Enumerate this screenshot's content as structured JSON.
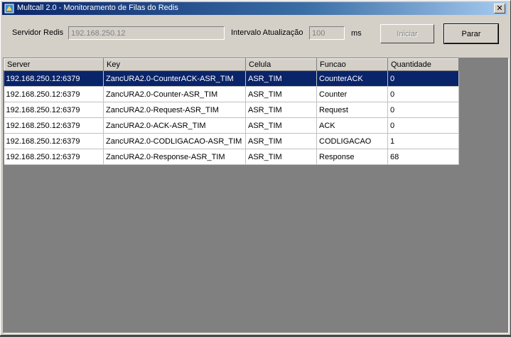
{
  "window": {
    "title": "Multcall 2.0 - Monitoramento de Filas do Redis",
    "close_glyph": "✕"
  },
  "form": {
    "server_label": "Servidor Redis",
    "server_value": "192.168.250.12",
    "interval_label": "Intervalo Atualização",
    "interval_value": "100",
    "interval_unit": "ms",
    "start_button": "Iniciar",
    "stop_button": "Parar"
  },
  "table": {
    "columns": [
      "Server",
      "Key",
      "Celula",
      "Funcao",
      "Quantidade"
    ],
    "rows": [
      [
        "192.168.250.12:6379",
        "ZancURA2.0-CounterACK-ASR_TIM",
        "ASR_TIM",
        "CounterACK",
        "0"
      ],
      [
        "192.168.250.12:6379",
        "ZancURA2.0-Counter-ASR_TIM",
        "ASR_TIM",
        "Counter",
        "0"
      ],
      [
        "192.168.250.12:6379",
        "ZancURA2.0-Request-ASR_TIM",
        "ASR_TIM",
        "Request",
        "0"
      ],
      [
        "192.168.250.12:6379",
        "ZancURA2.0-ACK-ASR_TIM",
        "ASR_TIM",
        "ACK",
        "0"
      ],
      [
        "192.168.250.12:6379",
        "ZancURA2.0-CODLIGACAO-ASR_TIM",
        "ASR_TIM",
        "CODLIGACAO",
        "1"
      ],
      [
        "192.168.250.12:6379",
        "ZancURA2.0-Response-ASR_TIM",
        "ASR_TIM",
        "Response",
        "68"
      ]
    ],
    "selected_row": 0
  },
  "colors": {
    "titlebar": "#0a246a",
    "selection": "#0a246a",
    "face": "#d4d0c8"
  },
  "icons": {
    "app": "app-icon",
    "close": "close-icon"
  }
}
